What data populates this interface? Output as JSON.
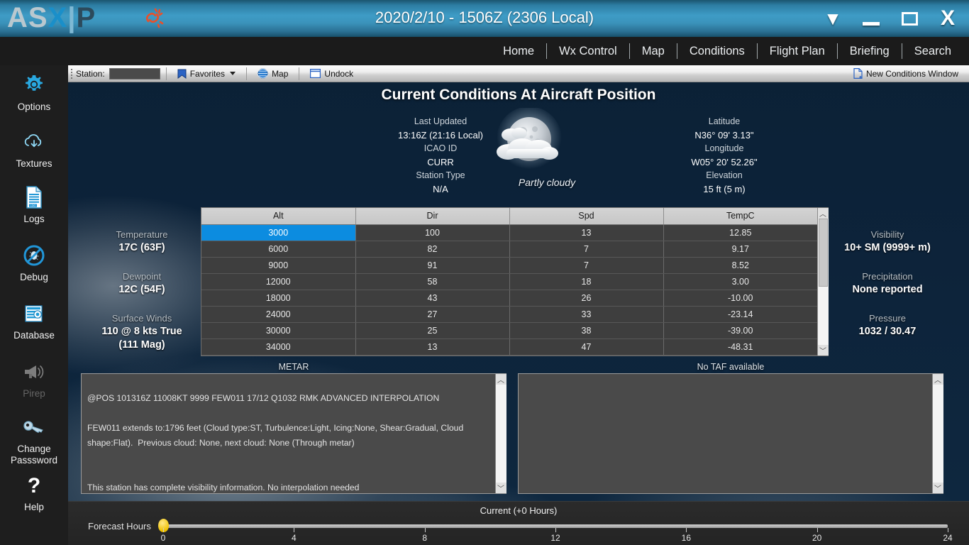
{
  "window": {
    "logo": {
      "as": "AS",
      "x": "X",
      "p": "P"
    },
    "title": "2020/2/10 - 1506Z (2306 Local)",
    "controls": {
      "collapse": "▼",
      "minimize": "minimize",
      "restore": "restore",
      "close": "X"
    }
  },
  "nav": {
    "items": [
      {
        "label": "Home"
      },
      {
        "label": "Wx Control"
      },
      {
        "label": "Map"
      },
      {
        "label": "Conditions"
      },
      {
        "label": "Flight Plan"
      },
      {
        "label": "Briefing"
      },
      {
        "label": "Search"
      }
    ]
  },
  "sidebar": {
    "items": [
      {
        "label": "Options",
        "icon": "gear-icon",
        "disabled": false
      },
      {
        "label": "Textures",
        "icon": "cloud-download-icon",
        "disabled": false
      },
      {
        "label": "Logs",
        "icon": "document-log-icon",
        "disabled": false
      },
      {
        "label": "Debug",
        "icon": "debug-bug-icon",
        "disabled": false
      },
      {
        "label": "Database",
        "icon": "database-icon",
        "disabled": false
      },
      {
        "label": "Pirep",
        "icon": "megaphone-icon",
        "disabled": true
      },
      {
        "label": "Change Passsword",
        "icon": "key-icon",
        "disabled": false
      },
      {
        "label": "Help",
        "icon": "question-mark-icon",
        "disabled": false
      }
    ]
  },
  "toolbar": {
    "station_label": "Station:",
    "station_value": "",
    "station_placeholder": "",
    "favorites_label": "Favorites",
    "map_label": "Map",
    "undock_label": "Undock",
    "new_window_label": "New Conditions Window"
  },
  "main": {
    "page_title": "Current Conditions At Aircraft Position",
    "left_header": [
      {
        "label": "Last Updated",
        "value": "13:16Z (21:16 Local)"
      },
      {
        "label": "ICAO ID",
        "value": "CURR"
      },
      {
        "label": "Station Type",
        "value": "N/A"
      }
    ],
    "right_header": [
      {
        "label": "Latitude",
        "value": "N36° 09' 3.13\""
      },
      {
        "label": "Longitude",
        "value": "W05° 20' 52.26\""
      },
      {
        "label": "Elevation",
        "value": "15 ft (5 m)"
      }
    ],
    "weather": {
      "icon": "moon-behind-cloud-icon",
      "caption": "Partly cloudy"
    },
    "stats_left": [
      {
        "label": "Temperature",
        "value": "17C (63F)"
      },
      {
        "label": "Dewpoint",
        "value": "12C (54F)"
      },
      {
        "label": "Surface Winds",
        "value": "110 @ 8 kts True",
        "value2": "(111 Mag)"
      }
    ],
    "stats_right": [
      {
        "label": "Visibility",
        "value": "10+ SM (9999+ m)"
      },
      {
        "label": "Precipitation",
        "value": "None reported"
      },
      {
        "label": "Pressure",
        "value": "1032 / 30.47"
      }
    ]
  },
  "winds_table": {
    "columns": [
      "Alt",
      "Dir",
      "Spd",
      "TempC"
    ],
    "selected_row_index": 0,
    "rows": [
      [
        "3000",
        "100",
        "13",
        "12.85"
      ],
      [
        "6000",
        "82",
        "7",
        "9.17"
      ],
      [
        "9000",
        "91",
        "7",
        "8.52"
      ],
      [
        "12000",
        "58",
        "18",
        "3.00"
      ],
      [
        "18000",
        "43",
        "26",
        "-10.00"
      ],
      [
        "24000",
        "27",
        "33",
        "-23.14"
      ],
      [
        "30000",
        "25",
        "38",
        "-39.00"
      ],
      [
        "34000",
        "13",
        "47",
        "-48.31"
      ]
    ]
  },
  "metar": {
    "title": "METAR",
    "body": "@POS 101316Z 11008KT 9999 FEW011 17/12 Q1032 RMK ADVANCED INTERPOLATION\n\nFEW011 extends to:1796 feet (Cloud type:ST, Turbulence:Light, Icing:None, Shear:Gradual, Cloud shape:Flat).  Previous cloud: None, next cloud: None (Through metar)",
    "tail": "This station has complete visibility information. No interpolation needed"
  },
  "taf": {
    "title": "No TAF available",
    "body": ""
  },
  "forecast": {
    "label": "Forecast Hours",
    "current": "Current (+0 Hours)",
    "value": 0,
    "min": 0,
    "max": 24,
    "ticks": [
      "0",
      "4",
      "8",
      "12",
      "16",
      "20",
      "24"
    ]
  },
  "colors": {
    "accent": "#0c8ce0",
    "title_bar": "#3e9cc6",
    "slider_thumb": "#efc100",
    "panel_bg": "#0d233a"
  }
}
